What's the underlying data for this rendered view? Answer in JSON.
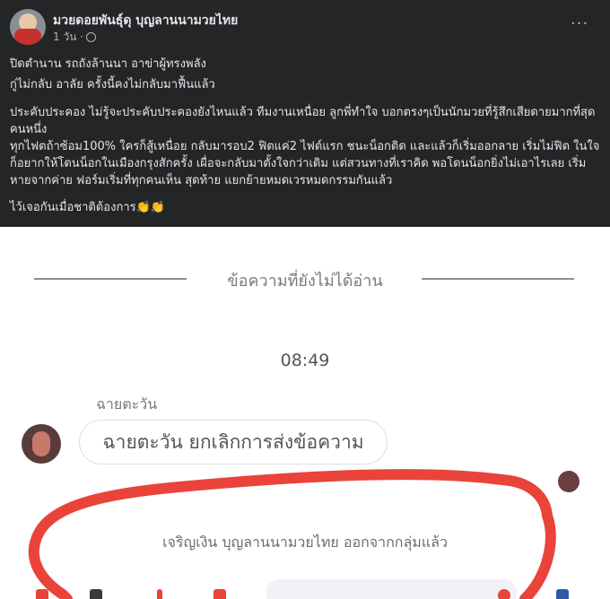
{
  "post": {
    "author": "มวยดอยพันธุ์ดุ บุญลานนามวยไทย",
    "time": "1 วัน ·",
    "more_label": "···",
    "paragraphs": [
      "ปิดตำนาน รถถังล้านนา อาข่าผู้ทรงพลัง",
      "กู่ไม่กลับ อาลัย ครั้งนี้คงไม่กลับมาฟื้นแล้ว",
      "ประคับประคอง ไม่รู้จะประคับประคองยังไหนแล้ว ทีมงานเหนื่อย ลูกพี่ทำใจ บอกตรงๆเป็นนักมวยที่รู้สึกเสียดายมากที่สุดคนหนึ่ง\nทุกไฟตถ้าซ้อม100% ใครก็สู้เหนื่อย กลับมารอบ2 ฟิตแค่2 ไฟต์แรก ชนะน็อกติด และแล้วก็เริ่มออกลาย เริ่มไม่ฟิต ในใจก็อยากให้โดนน็อกในเมืองกรุงสักครั้ง เผื่อจะกลับมาตั้งใจกว่าเดิม แต่สวนทางที่เราคิด พอโดนน็อกยิ่งไม่เอาไรเลย เริ่มหายจากค่าย ฟอร์มเริ่มที่ทุกคนเห็น สุดท้าย แยกย้ายหมดเวรหมดกรรมกันแล้ว",
      "ไว้เจอกันเมื่อชาติต้องการ"
    ],
    "emoji": "👏👏"
  },
  "chat": {
    "unread_label": "ข้อความที่ยังไม่ได้อ่าน",
    "time": "08:49",
    "sender_name": "ฉายตะวัน",
    "bubble_text": "ฉายตะวัน ยกเลิกการส่งข้อความ",
    "system_message": "เจริญเงิน บุญลานนามวยไทย ออกจากกลุ่มแล้ว"
  },
  "colors": {
    "background": "#242526",
    "annotation": "#e9433a"
  }
}
